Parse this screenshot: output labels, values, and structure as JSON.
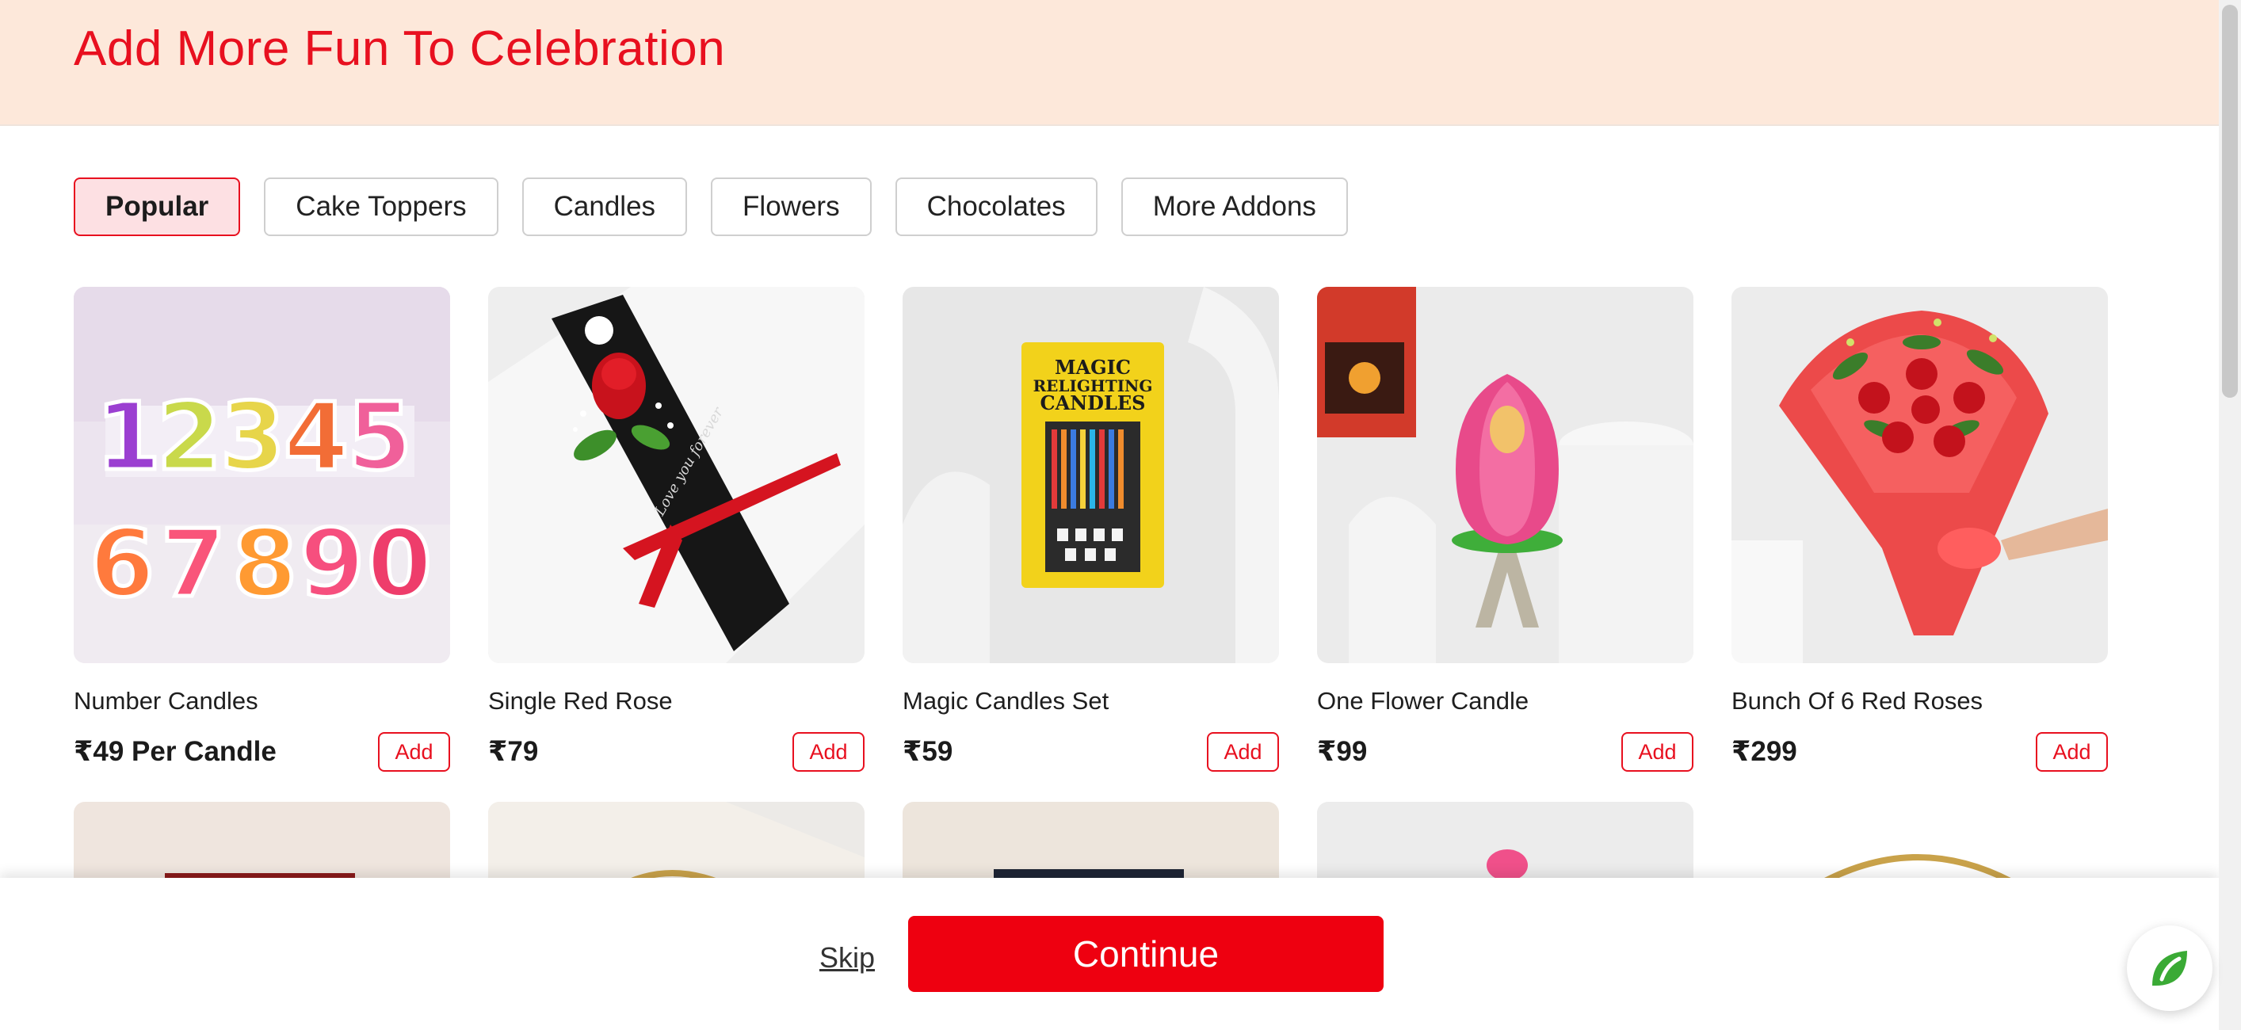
{
  "header": {
    "title": "Add More Fun To Celebration"
  },
  "tabs": [
    {
      "label": "Popular",
      "active": true
    },
    {
      "label": "Cake Toppers",
      "active": false
    },
    {
      "label": "Candles",
      "active": false
    },
    {
      "label": "Flowers",
      "active": false
    },
    {
      "label": "Chocolates",
      "active": false
    },
    {
      "label": "More Addons",
      "active": false
    }
  ],
  "products": [
    {
      "name": "Number Candles",
      "price": "₹49 Per Candle",
      "add_label": "Add"
    },
    {
      "name": "Single Red Rose",
      "price": "₹79",
      "add_label": "Add"
    },
    {
      "name": "Magic Candles Set",
      "price": "₹59",
      "add_label": "Add"
    },
    {
      "name": "One Flower Candle",
      "price": "₹99",
      "add_label": "Add"
    },
    {
      "name": "Bunch Of 6 Red Roses",
      "price": "₹299",
      "add_label": "Add"
    }
  ],
  "image_text": {
    "candle_pack": [
      "MAGIC",
      "RELIGHTING",
      "CANDLES"
    ],
    "rose_wrap": "Love you forever"
  },
  "footer": {
    "skip_label": "Skip",
    "continue_label": "Continue"
  },
  "colors": {
    "accent": "#e8101f",
    "header_bg": "#fde8da",
    "active_tab_bg": "#fde0e3",
    "continue_bg": "#ee0010",
    "chat_green": "#3aaa35"
  },
  "icons": {
    "chat": "leaf-chat-icon"
  }
}
